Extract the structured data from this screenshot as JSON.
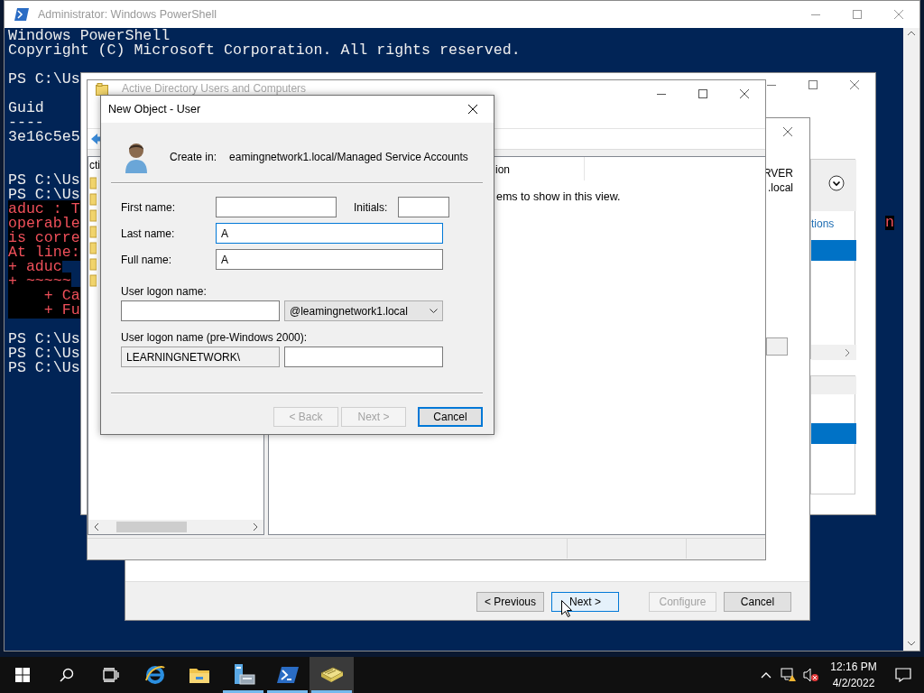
{
  "powershell": {
    "title": "Administrator: Windows PowerShell",
    "lines": [
      {
        "kind": "output",
        "text": "Windows PowerShell"
      },
      {
        "kind": "output",
        "text": "Copyright (C) Microsoft Corporation. All rights reserved."
      },
      {
        "kind": "blank"
      },
      {
        "kind": "output",
        "text": "PS C:\\Us"
      },
      {
        "kind": "blank"
      },
      {
        "kind": "output",
        "text": "Guid"
      },
      {
        "kind": "output",
        "text": "----"
      },
      {
        "kind": "output",
        "text": "3e16c5e5"
      },
      {
        "kind": "blank"
      },
      {
        "kind": "blank"
      },
      {
        "kind": "output",
        "text": "PS C:\\Us"
      },
      {
        "kind": "output",
        "text": "PS C:\\Us"
      },
      {
        "kind": "error",
        "text": "aduc : T"
      },
      {
        "kind": "error",
        "text": "operable"
      },
      {
        "kind": "error",
        "text": "is corre"
      },
      {
        "kind": "error",
        "text": "At line:"
      },
      {
        "kind": "error",
        "text": "+ aduc"
      },
      {
        "kind": "error",
        "text": "+ ~~~~~"
      },
      {
        "kind": "error",
        "text": "    + Ca"
      },
      {
        "kind": "error",
        "text": "    + Fu"
      },
      {
        "kind": "blank"
      },
      {
        "kind": "output",
        "text": "PS C:\\Us"
      },
      {
        "kind": "output",
        "text": "PS C:\\Us"
      },
      {
        "kind": "output",
        "text": "PS C:\\Us"
      }
    ],
    "error_fragment": "n"
  },
  "server_manager": {
    "tasks_link": "tions"
  },
  "wizard": {
    "server_lines": [
      "RVER",
      ".local"
    ],
    "buttons": [
      {
        "label": "< Previous",
        "disabled": false,
        "selected": false
      },
      {
        "label": "Next >",
        "disabled": false,
        "selected": true
      },
      {
        "label": "Configure",
        "disabled": true,
        "selected": false
      },
      {
        "label": "Cancel",
        "disabled": false,
        "selected": false
      }
    ]
  },
  "aduc": {
    "title": "Active Directory Users and Computers",
    "tree_root": "cti",
    "column_header": "ion",
    "empty_message": "ems to show in this view."
  },
  "dialog": {
    "title": "New Object - User",
    "create_in": {
      "label": "Create in:",
      "path": "eamingnetwork1.local/Managed Service Accounts"
    },
    "first_name": {
      "label": "First name:",
      "focused": false
    },
    "initials": {
      "label": "Initials:",
      "focused": false
    },
    "last_name": {
      "label": "Last name:",
      "value": "A",
      "focused": true
    },
    "full_name": {
      "label": "Full name:",
      "value": "A",
      "focused": false
    },
    "logon_name": {
      "label": "User logon name:",
      "domain": "@leamingnetwork1.local"
    },
    "pre2000": {
      "label": "User logon name (pre-Windows 2000):",
      "prefix": "LEARNINGNETWORK\\"
    },
    "buttons": [
      {
        "label": "< Back",
        "disabled": true,
        "default": false
      },
      {
        "label": "Next >",
        "disabled": true,
        "default": false
      },
      {
        "label": "Cancel",
        "disabled": false,
        "default": true
      }
    ]
  },
  "taskbar": {
    "apps": [
      {
        "kind": "start"
      },
      {
        "kind": "search"
      },
      {
        "kind": "task_view"
      },
      {
        "kind": "ie",
        "running": false,
        "selected": false
      },
      {
        "kind": "explorer",
        "running": false,
        "selected": false
      },
      {
        "kind": "server_manager",
        "running": true,
        "selected": false
      },
      {
        "kind": "powershell",
        "running": true,
        "selected": false
      },
      {
        "kind": "aduc",
        "running": true,
        "selected": true
      }
    ],
    "time": "12:16 PM",
    "date": "4/2/2022"
  }
}
